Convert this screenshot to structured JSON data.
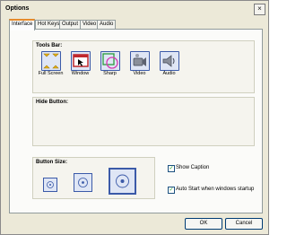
{
  "window": {
    "title": "Options",
    "close_glyph": "×"
  },
  "tabs": [
    {
      "label": "Interface",
      "active": true
    },
    {
      "label": "Hot Keys"
    },
    {
      "label": "Output"
    },
    {
      "label": "Video"
    },
    {
      "label": "Audio"
    }
  ],
  "tools_bar": {
    "title": "Tools Bar:",
    "items": [
      {
        "label": "Full Screen",
        "icon": "fullscreen-icon"
      },
      {
        "label": "Window",
        "icon": "window-icon"
      },
      {
        "label": "Sharp",
        "icon": "sharp-icon"
      },
      {
        "label": "Video",
        "icon": "video-icon"
      },
      {
        "label": "Audio",
        "icon": "audio-icon"
      }
    ]
  },
  "hide_button": {
    "title": "Hide Button:"
  },
  "button_size": {
    "title": "Button Size:",
    "sizes": [
      "small",
      "medium",
      "large"
    ],
    "selected": "large"
  },
  "options": {
    "show_caption": {
      "label": "Show Caption",
      "checked": true
    },
    "auto_start": {
      "label": "Auto Start when windows startup",
      "checked": true
    }
  },
  "buttons": {
    "ok": "OK",
    "cancel": "Cancel"
  },
  "colors": {
    "tab_accent": "#e68b2c",
    "button_blue": "#3b5aa8"
  }
}
